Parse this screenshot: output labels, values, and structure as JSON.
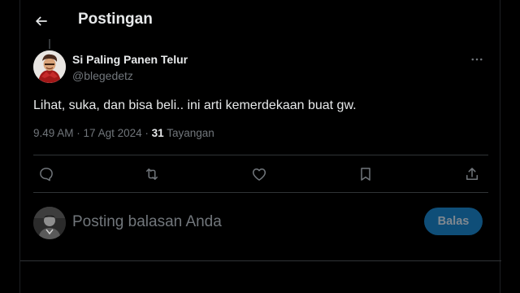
{
  "header": {
    "back_icon": "arrow-left-icon",
    "title": "Postingan"
  },
  "post": {
    "author_name": "Si Paling Panen Telur",
    "author_handle": "@blegedetz",
    "more_icon": "more-horizontal-icon",
    "text": "Lihat, suka, dan bisa beli.. ini arti kemerdekaan buat gw.",
    "time": "9.49 AM",
    "date": "17 Agt 2024",
    "views_count": "31",
    "views_label": "Tayangan"
  },
  "actions": [
    {
      "name": "reply",
      "icon": "comment-icon"
    },
    {
      "name": "repost",
      "icon": "repost-icon"
    },
    {
      "name": "like",
      "icon": "heart-icon"
    },
    {
      "name": "bookmark",
      "icon": "bookmark-icon"
    },
    {
      "name": "share",
      "icon": "share-icon"
    }
  ],
  "reply_box": {
    "placeholder": "Posting balasan Anda",
    "button_label": "Balas"
  },
  "colors": {
    "background": "#000000",
    "text_primary": "#e7e9ea",
    "text_secondary": "#71767b",
    "divider": "#2f3336",
    "button_disabled": "#0f4e78"
  }
}
